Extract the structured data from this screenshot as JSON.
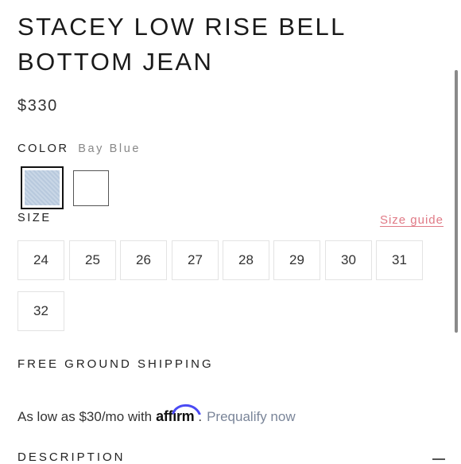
{
  "product": {
    "title": "STACEY LOW RISE BELL BOTTOM JEAN",
    "price": "$330"
  },
  "color": {
    "label": "COLOR",
    "selected": "Bay Blue",
    "swatches": [
      {
        "name": "Bay Blue",
        "color": "#bccde0",
        "selected": true
      },
      {
        "name": "White",
        "color": "#ffffff",
        "selected": false
      }
    ]
  },
  "size": {
    "label": "SIZE",
    "guide_label": "Size guide",
    "guide_color": "#e07a86",
    "options": [
      "24",
      "25",
      "26",
      "27",
      "28",
      "29",
      "30",
      "31",
      "32"
    ]
  },
  "shipping": {
    "label": "FREE GROUND SHIPPING"
  },
  "affirm": {
    "prefix": "As low as $30/mo with",
    "brand": "affirm",
    "separator": ".",
    "link": "Prequalify now",
    "brand_arc_color": "#4a4af4"
  },
  "description": {
    "label": "DESCRIPTION"
  }
}
